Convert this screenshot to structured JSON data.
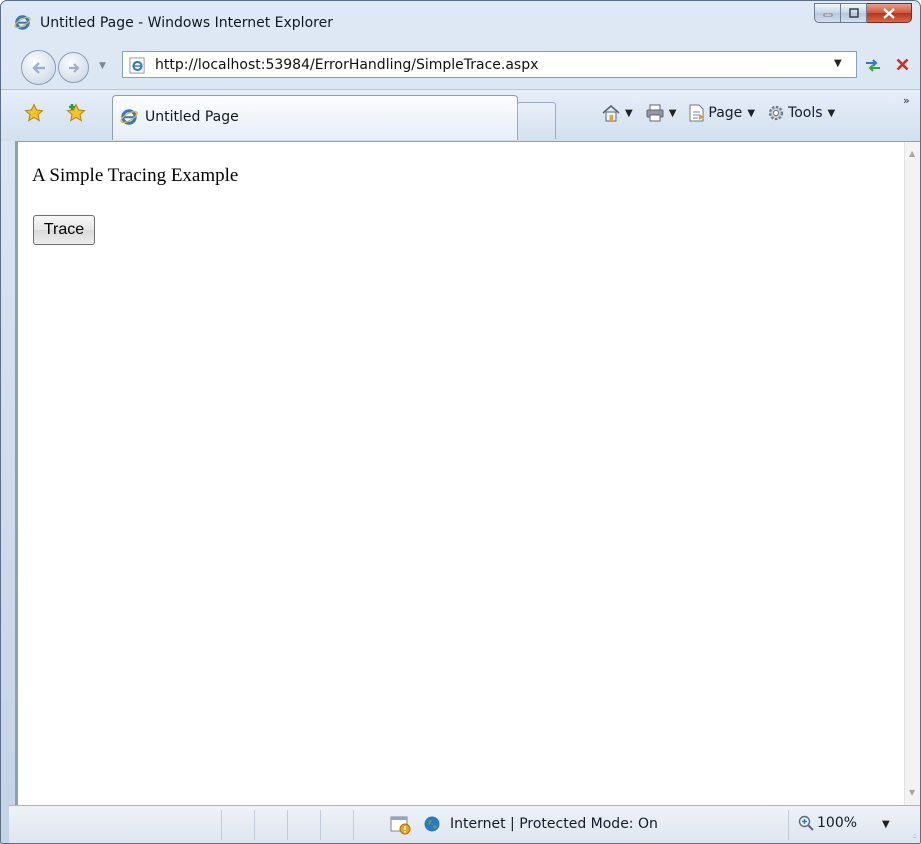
{
  "window": {
    "title": "Untitled Page - Windows Internet Explorer"
  },
  "address_bar": {
    "url": "http://localhost:53984/ErrorHandling/SimpleTrace.aspx"
  },
  "tabs": [
    {
      "label": "Untitled Page",
      "active": true
    }
  ],
  "command_bar": {
    "page_label": "Page",
    "tools_label": "Tools"
  },
  "page": {
    "heading": "A Simple Tracing Example",
    "trace_button_label": "Trace"
  },
  "status_bar": {
    "zone_text": "Internet | Protected Mode: On",
    "zoom": "100%"
  },
  "colors": {
    "chrome_blue": "#d3e0ef",
    "close_red": "#cf5a3f",
    "ie_blue": "#2f79c8"
  }
}
